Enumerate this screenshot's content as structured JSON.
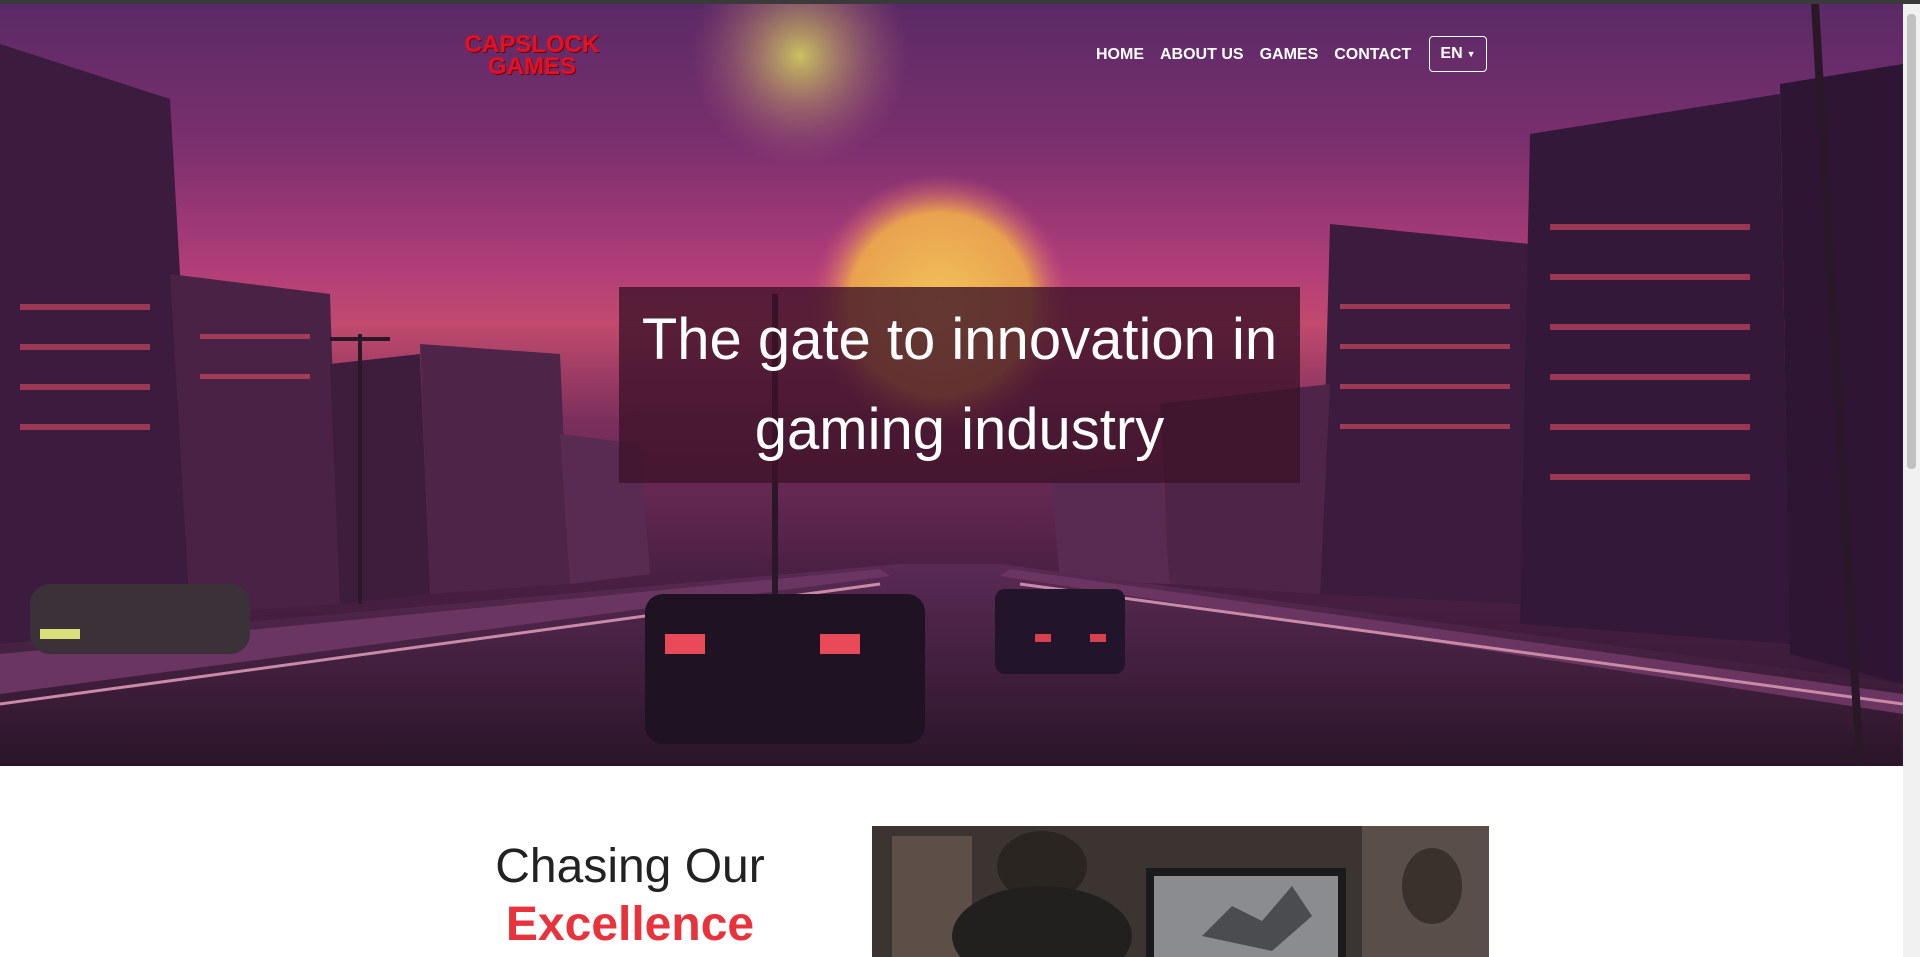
{
  "brand": {
    "line1": "CAPSLOCK",
    "line2": "GAMES",
    "color": "#e8101e"
  },
  "nav": {
    "items": [
      {
        "label": "HOME"
      },
      {
        "label": "ABOUT US"
      },
      {
        "label": "GAMES"
      },
      {
        "label": "CONTACT"
      }
    ],
    "language": "EN"
  },
  "hero": {
    "headline_line1": "The gate to innovation in",
    "headline_line2": "gaming industry"
  },
  "section": {
    "title_line1": "Chasing Our",
    "title_line2": "Excellence",
    "accent_color": "#e8323c"
  }
}
